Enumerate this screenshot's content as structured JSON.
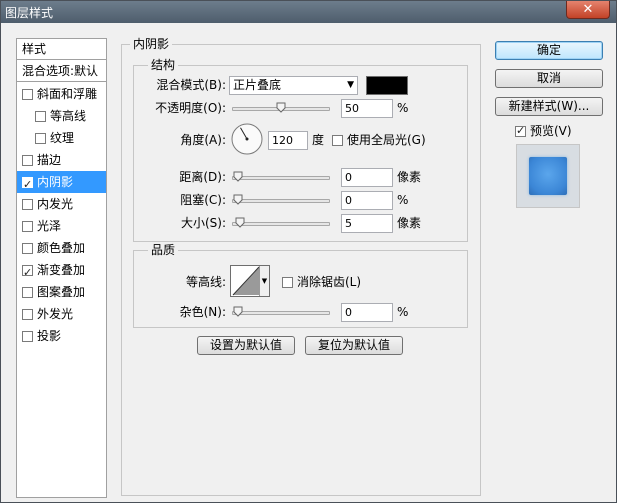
{
  "window": {
    "title": "图层样式",
    "close_glyph": "✕"
  },
  "style_list": {
    "header": "样式",
    "blend_defaults": "混合选项:默认",
    "items": [
      {
        "label": "斜面和浮雕",
        "checked": false,
        "indent": false,
        "selected": false
      },
      {
        "label": "等高线",
        "checked": false,
        "indent": true,
        "selected": false
      },
      {
        "label": "纹理",
        "checked": false,
        "indent": true,
        "selected": false
      },
      {
        "label": "描边",
        "checked": false,
        "indent": false,
        "selected": false
      },
      {
        "label": "内阴影",
        "checked": true,
        "indent": false,
        "selected": true
      },
      {
        "label": "内发光",
        "checked": false,
        "indent": false,
        "selected": false
      },
      {
        "label": "光泽",
        "checked": false,
        "indent": false,
        "selected": false
      },
      {
        "label": "颜色叠加",
        "checked": false,
        "indent": false,
        "selected": false
      },
      {
        "label": "渐变叠加",
        "checked": true,
        "indent": false,
        "selected": false
      },
      {
        "label": "图案叠加",
        "checked": false,
        "indent": false,
        "selected": false
      },
      {
        "label": "外发光",
        "checked": false,
        "indent": false,
        "selected": false
      },
      {
        "label": "投影",
        "checked": false,
        "indent": false,
        "selected": false
      }
    ]
  },
  "panel": {
    "title": "内阴影",
    "structure": {
      "title": "结构",
      "blend_mode_label": "混合模式(B):",
      "blend_mode_value": "正片叠底",
      "shadow_color": "#000000",
      "opacity_label": "不透明度(O):",
      "opacity_value": "50",
      "opacity_unit": "%",
      "angle_label": "角度(A):",
      "angle_value": "120",
      "angle_unit": "度",
      "global_light_label": "使用全局光(G)",
      "global_light_checked": false,
      "distance_label": "距离(D):",
      "distance_value": "0",
      "distance_unit": "像素",
      "choke_label": "阻塞(C):",
      "choke_value": "0",
      "choke_unit": "%",
      "size_label": "大小(S):",
      "size_value": "5",
      "size_unit": "像素"
    },
    "quality": {
      "title": "品质",
      "contour_label": "等高线:",
      "antialias_label": "消除锯齿(L)",
      "antialias_checked": false,
      "noise_label": "杂色(N):",
      "noise_value": "0",
      "noise_unit": "%"
    },
    "make_default": "设置为默认值",
    "reset_default": "复位为默认值"
  },
  "buttons": {
    "ok": "确定",
    "cancel": "取消",
    "new_style": "新建样式(W)...",
    "preview_label": "预览(V)",
    "preview_checked": true
  },
  "colors": {
    "selection": "#3399ff",
    "titlebar": "#5d6c7b",
    "preview_fill": "#3b86d6"
  }
}
